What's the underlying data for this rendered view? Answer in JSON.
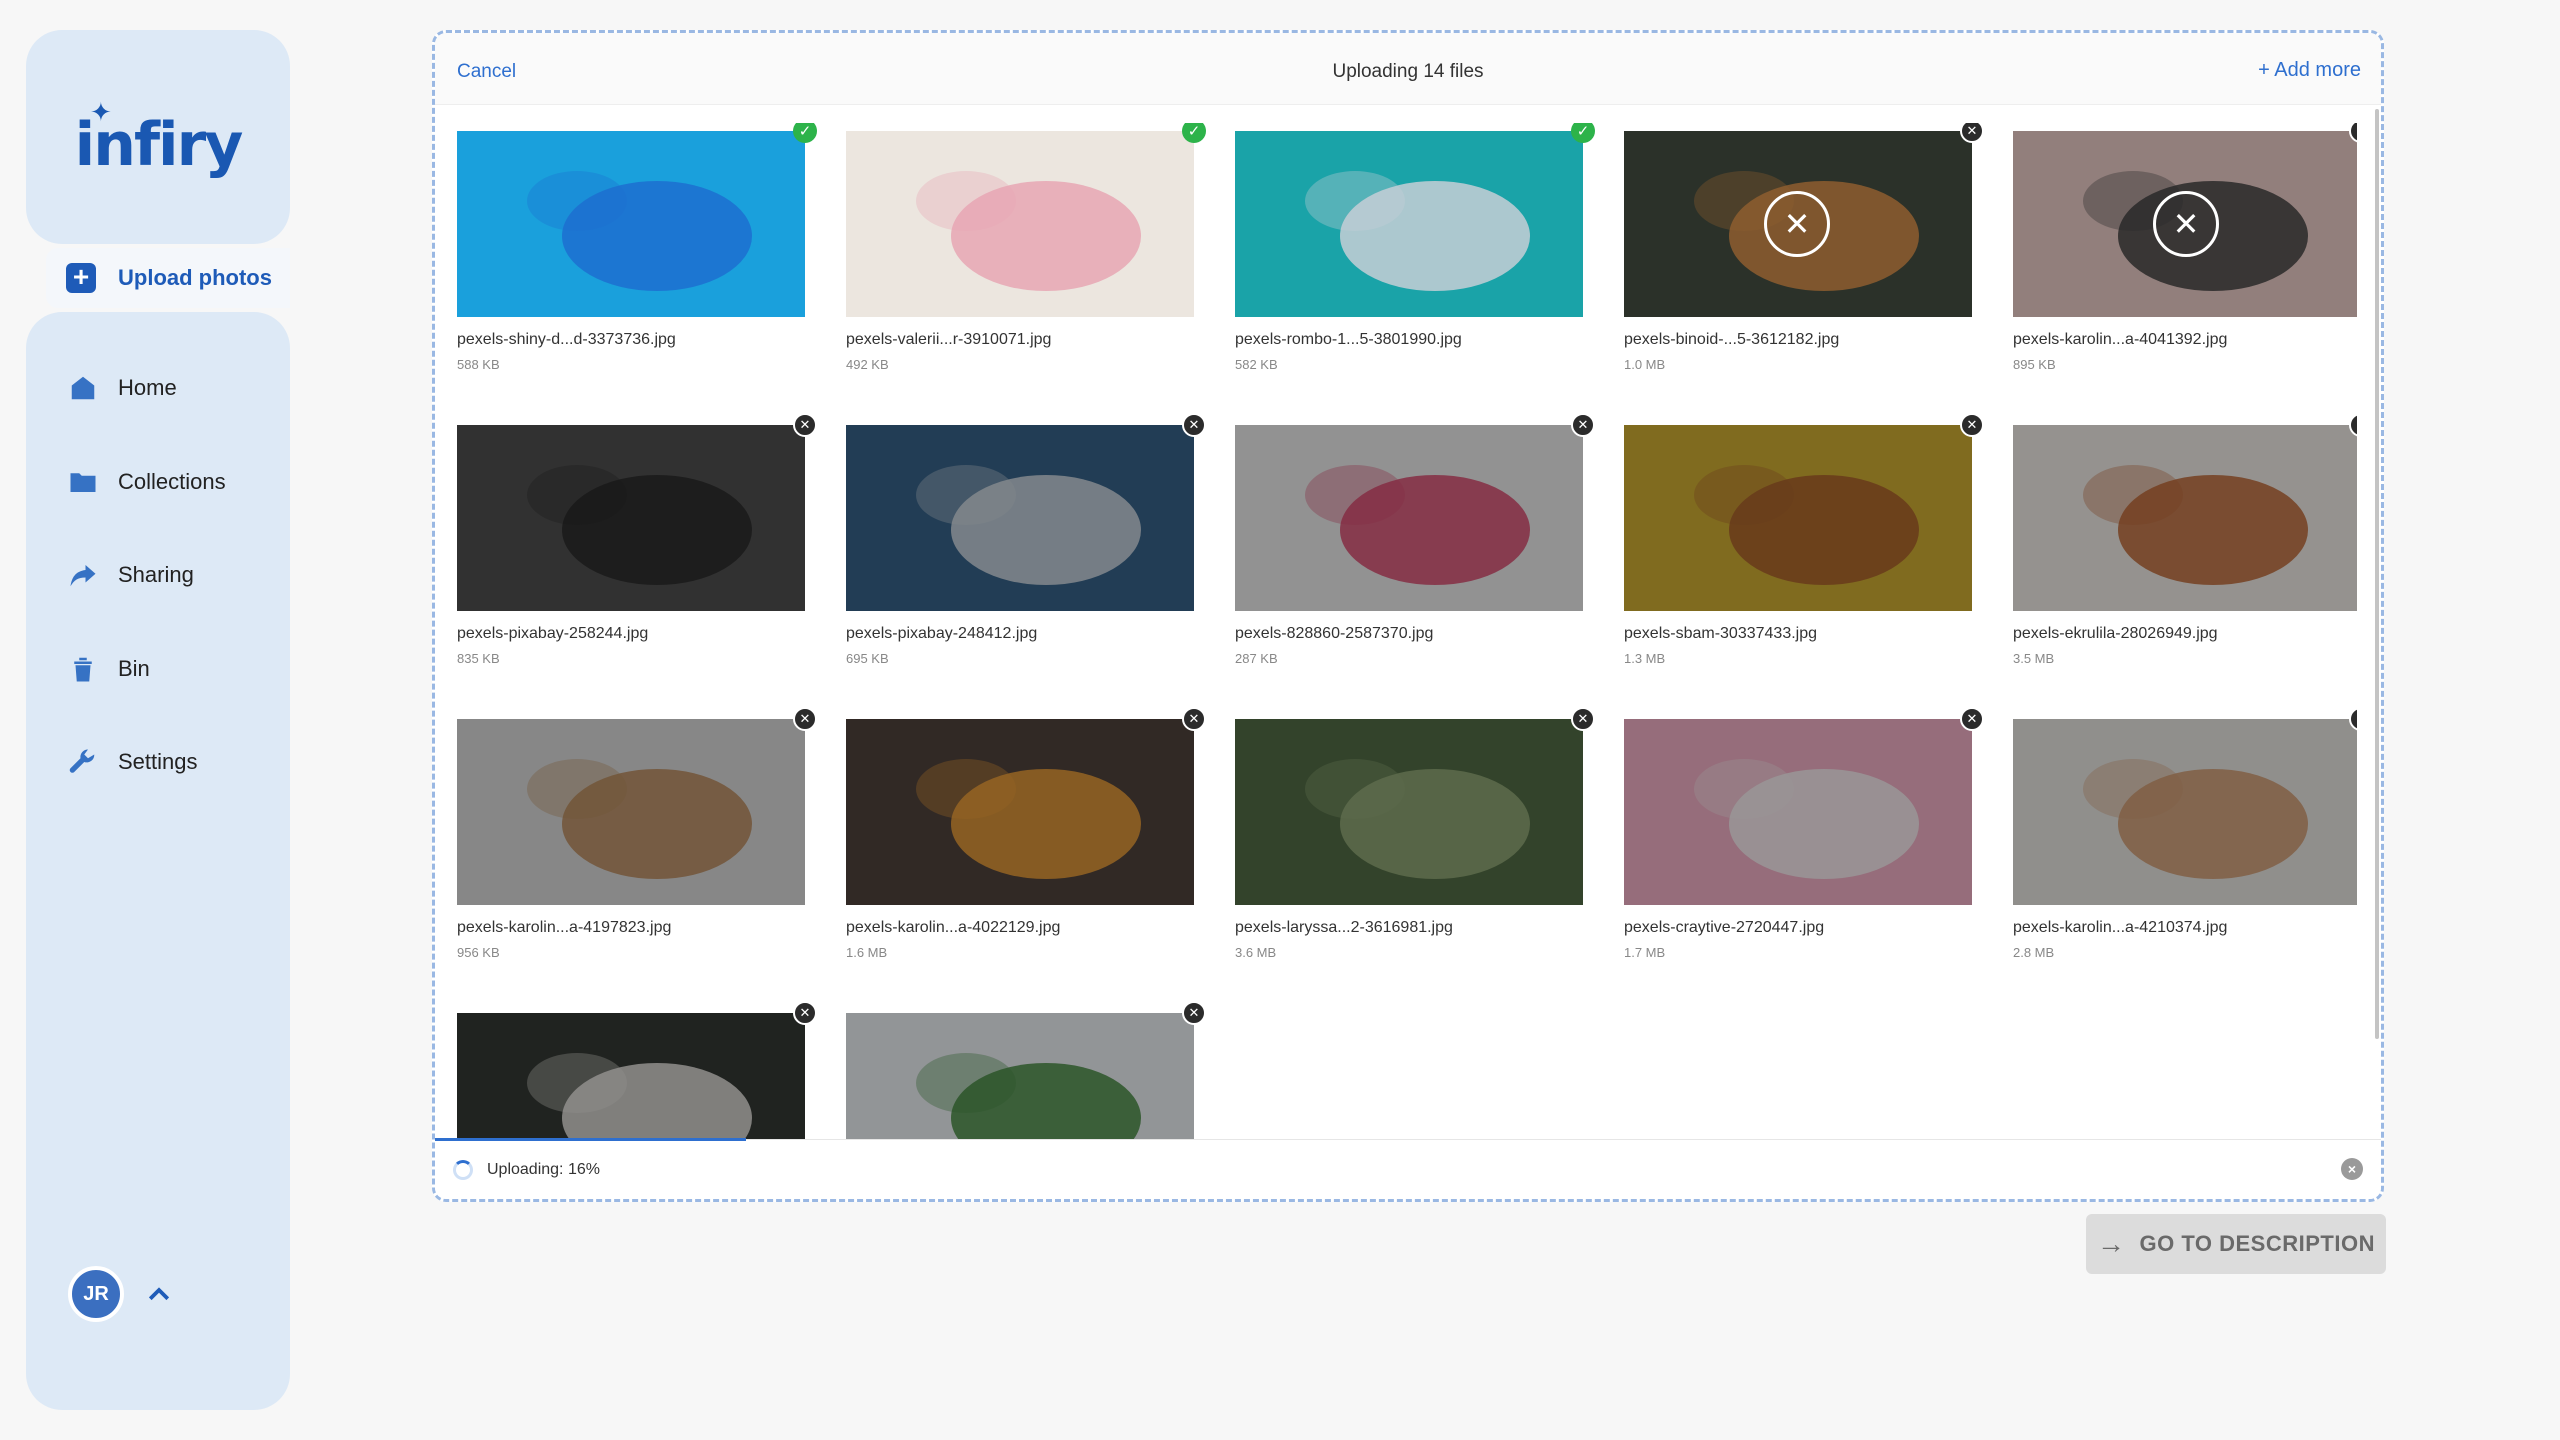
{
  "app": {
    "logo": "infiry"
  },
  "sidebar": {
    "upload_label": "Upload photos",
    "items": [
      {
        "label": "Home",
        "icon": "home-icon"
      },
      {
        "label": "Collections",
        "icon": "folder-icon"
      },
      {
        "label": "Sharing",
        "icon": "share-icon"
      },
      {
        "label": "Bin",
        "icon": "trash-icon"
      },
      {
        "label": "Settings",
        "icon": "wrench-icon"
      }
    ],
    "user_initials": "JR"
  },
  "panel": {
    "cancel_label": "Cancel",
    "title": "Uploading 14 files",
    "add_more_label": "+ Add more",
    "status_text": "Uploading: 16%",
    "progress": 0.16
  },
  "files": [
    {
      "name": "pexels-shiny-d...d-3373736.jpg",
      "size": "588 KB",
      "state": "done"
    },
    {
      "name": "pexels-valerii...r-3910071.jpg",
      "size": "492 KB",
      "state": "done"
    },
    {
      "name": "pexels-rombo-1...5-3801990.jpg",
      "size": "582 KB",
      "state": "done"
    },
    {
      "name": "pexels-binoid-...5-3612182.jpg",
      "size": "1.0 MB",
      "state": "error"
    },
    {
      "name": "pexels-karolin...a-4041392.jpg",
      "size": "895 KB",
      "state": "error"
    },
    {
      "name": "pexels-pixabay-258244.jpg",
      "size": "835 KB",
      "state": "pending"
    },
    {
      "name": "pexels-pixabay-248412.jpg",
      "size": "695 KB",
      "state": "pending"
    },
    {
      "name": "pexels-828860-2587370.jpg",
      "size": "287 KB",
      "state": "pending"
    },
    {
      "name": "pexels-sbam-30337433.jpg",
      "size": "1.3 MB",
      "state": "pending"
    },
    {
      "name": "pexels-ekrulila-28026949.jpg",
      "size": "3.5 MB",
      "state": "pending"
    },
    {
      "name": "pexels-karolin...a-4197823.jpg",
      "size": "956 KB",
      "state": "pending"
    },
    {
      "name": "pexels-karolin...a-4022129.jpg",
      "size": "1.6 MB",
      "state": "pending"
    },
    {
      "name": "pexels-laryssa...2-3616981.jpg",
      "size": "3.6 MB",
      "state": "pending"
    },
    {
      "name": "pexels-craytive-2720447.jpg",
      "size": "1.7 MB",
      "state": "pending"
    },
    {
      "name": "pexels-karolin...a-4210374.jpg",
      "size": "2.8 MB",
      "state": "pending"
    },
    {
      "name": "",
      "size": "",
      "state": "pending"
    },
    {
      "name": "",
      "size": "",
      "state": "pending"
    }
  ],
  "thumb_colors": [
    [
      "#1aa0dc",
      "#1d6fd0"
    ],
    [
      "#ece6df",
      "#e7a6b4"
    ],
    [
      "#1aa3a8",
      "#c7cfd6"
    ],
    [
      "#2f3a2a",
      "#e08a35"
    ],
    [
      "#e9c6c1",
      "#2a2a2a"
    ],
    [
      "#3a3a3a",
      "#0f0f0f"
    ],
    [
      "#1e4f7a",
      "#cfd8e0"
    ],
    [
      "#e9e9e9",
      "#d2325a"
    ],
    [
      "#c9a319",
      "#9d4a12"
    ],
    [
      "#efeae4",
      "#b4531c"
    ],
    [
      "#d6d6d6",
      "#b07a45"
    ],
    [
      "#3a2a24",
      "#f0961f"
    ],
    [
      "#3d5a2e",
      "#8aa36a"
    ],
    [
      "#f1a7bf",
      "#f7f0f2"
    ],
    [
      "#e6e3df",
      "#c98c5d"
    ],
    [
      "#1a1f1a",
      "#e8e4e0"
    ],
    [
      "#e9eef2",
      "#2f7a2a"
    ]
  ],
  "go_button_label": "GO TO DESCRIPTION"
}
